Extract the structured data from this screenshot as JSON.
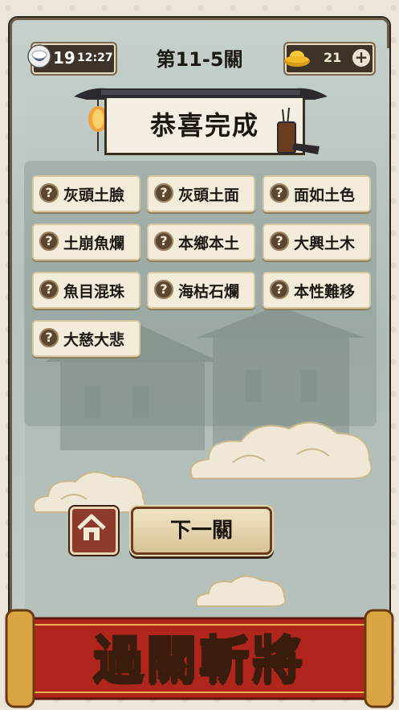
{
  "status_bar": {
    "lives": "19",
    "timer": "12:27",
    "coins": "21",
    "plus_label": "+"
  },
  "header": {
    "level_title": "第11-5關"
  },
  "result": {
    "title": "恭喜完成"
  },
  "idioms": [
    {
      "icon": "?",
      "text": "灰頭土臉"
    },
    {
      "icon": "?",
      "text": "灰頭土面"
    },
    {
      "icon": "?",
      "text": "面如土色"
    },
    {
      "icon": "?",
      "text": "土崩魚爛"
    },
    {
      "icon": "?",
      "text": "本鄉本土"
    },
    {
      "icon": "?",
      "text": "大興土木"
    },
    {
      "icon": "?",
      "text": "魚目混珠"
    },
    {
      "icon": "?",
      "text": "海枯石爛"
    },
    {
      "icon": "?",
      "text": "本性難移"
    },
    {
      "icon": "?",
      "text": "大慈大悲"
    }
  ],
  "buttons": {
    "next_label": "下一關"
  },
  "banner": {
    "text": "過關斬將"
  },
  "colors": {
    "accent_gold": "#f6d86a",
    "home_red": "#8c3a2c",
    "chip_bg": "#f3ecda"
  }
}
